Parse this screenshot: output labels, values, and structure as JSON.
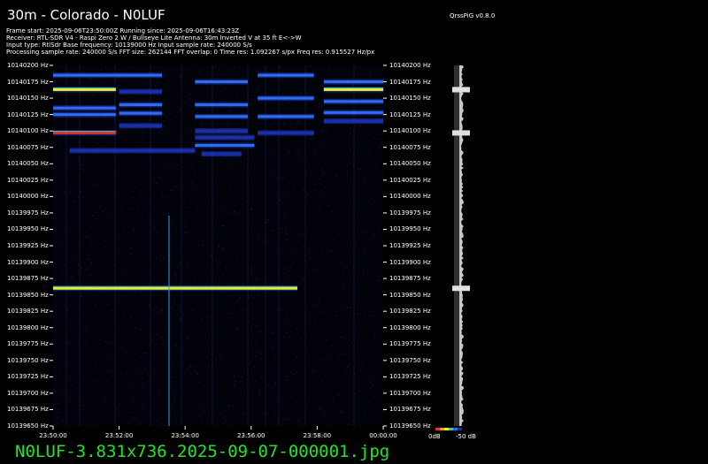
{
  "header": {
    "title": "30m - Colorado - N0LUF",
    "version": "QrssPiG v0.8.0",
    "info_lines": [
      "Frame start: 2025-09-06T23:50:00Z Running since: 2025-09-06T16:43:23Z",
      "Receiver: RTL-SDR V4 - Raspi Zero 2 W / Bullseye Lite Antenna: 30m Inverted V at 35 ft E<->W",
      "Input type: RtlSdr Base frequency: 10139000 Hz Input sample rate: 240000 S/s",
      "Processing sample rate: 240000 S/s FFT size: 262144 FFT overlap: 0 Time res: 1.092267 s/px Freq res: 0.915527 Hz/px"
    ]
  },
  "footer": {
    "filename": "N0LUF-3.831x736.2025-09-07-000001.jpg"
  },
  "colors": {
    "background": "#000000",
    "weak_signal": "#1a2fb0",
    "strong_signal": "#e8f020",
    "hot_signal": "#e83020",
    "filename_text": "#22e22b"
  },
  "chart_data": {
    "type": "heatmap",
    "x": [
      "23:50:00",
      "23:52:00",
      "23:54:00",
      "23:56:00",
      "23:58:00",
      "00:00:00"
    ],
    "y_ticks": [
      10140200,
      10140175,
      10140150,
      10140125,
      10140100,
      10140075,
      10140050,
      10140025,
      10140000,
      10139975,
      10139950,
      10139925,
      10139900,
      10139875,
      10139850,
      10139825,
      10139800,
      10139775,
      10139750,
      10139725,
      10139700,
      10139675,
      10139650
    ],
    "y_unit": "Hz",
    "ylim": [
      10139650,
      10140200
    ],
    "colorbar_labels": [
      "0dB",
      "-50 dB"
    ],
    "signals": [
      {
        "t_start": 0,
        "t_end": 3.3,
        "freq": 10140185,
        "strength": "medium"
      },
      {
        "t_start": 0,
        "t_end": 1.9,
        "freq": 10140163,
        "strength": "strong"
      },
      {
        "t_start": 0,
        "t_end": 1.9,
        "freq": 10140135,
        "strength": "medium"
      },
      {
        "t_start": 0,
        "t_end": 1.9,
        "freq": 10140125,
        "strength": "medium"
      },
      {
        "t_start": 0,
        "t_end": 1.9,
        "freq": 10140097,
        "strength": "hot"
      },
      {
        "t_start": 2.0,
        "t_end": 3.3,
        "freq": 10140160,
        "strength": "weak"
      },
      {
        "t_start": 2.0,
        "t_end": 3.3,
        "freq": 10140140,
        "strength": "medium"
      },
      {
        "t_start": 2.0,
        "t_end": 3.3,
        "freq": 10140127,
        "strength": "medium"
      },
      {
        "t_start": 2.0,
        "t_end": 3.3,
        "freq": 10140108,
        "strength": "weak"
      },
      {
        "t_start": 4.3,
        "t_end": 5.9,
        "freq": 10140175,
        "strength": "medium"
      },
      {
        "t_start": 4.3,
        "t_end": 5.9,
        "freq": 10140140,
        "strength": "medium"
      },
      {
        "t_start": 4.3,
        "t_end": 5.9,
        "freq": 10140122,
        "strength": "medium"
      },
      {
        "t_start": 4.3,
        "t_end": 5.9,
        "freq": 10140100,
        "strength": "weak"
      },
      {
        "t_start": 4.3,
        "t_end": 6.1,
        "freq": 10140090,
        "strength": "weak"
      },
      {
        "t_start": 4.3,
        "t_end": 6.1,
        "freq": 10140078,
        "strength": "medium"
      },
      {
        "t_start": 4.5,
        "t_end": 5.7,
        "freq": 10140065,
        "strength": "weak"
      },
      {
        "t_start": 6.2,
        "t_end": 7.9,
        "freq": 10140185,
        "strength": "medium"
      },
      {
        "t_start": 6.2,
        "t_end": 7.9,
        "freq": 10140150,
        "strength": "medium"
      },
      {
        "t_start": 6.2,
        "t_end": 7.9,
        "freq": 10140122,
        "strength": "medium"
      },
      {
        "t_start": 6.2,
        "t_end": 7.9,
        "freq": 10140097,
        "strength": "weak"
      },
      {
        "t_start": 8.2,
        "t_end": 10.0,
        "freq": 10140175,
        "strength": "medium"
      },
      {
        "t_start": 8.2,
        "t_end": 10.0,
        "freq": 10140163,
        "strength": "strong"
      },
      {
        "t_start": 8.2,
        "t_end": 10.0,
        "freq": 10140145,
        "strength": "medium"
      },
      {
        "t_start": 8.2,
        "t_end": 10.0,
        "freq": 10140128,
        "strength": "medium"
      },
      {
        "t_start": 8.2,
        "t_end": 10.0,
        "freq": 10140115,
        "strength": "weak"
      },
      {
        "t_start": 0.5,
        "t_end": 4.3,
        "freq": 10140070,
        "strength": "weak"
      },
      {
        "t_start": 0,
        "t_end": 7.4,
        "freq": 10139860,
        "strength": "strong"
      }
    ]
  }
}
